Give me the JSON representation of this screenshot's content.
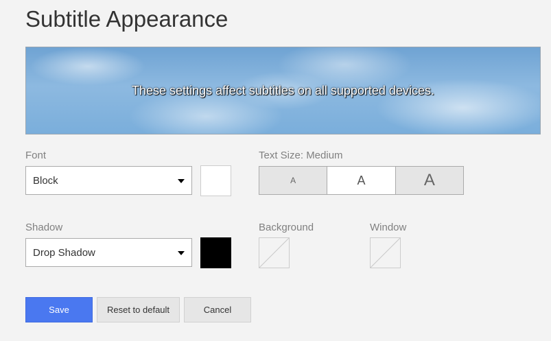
{
  "page": {
    "title": "Subtitle Appearance"
  },
  "preview": {
    "text": "These settings affect subtitles on all supported devices."
  },
  "font": {
    "label": "Font",
    "value": "Block",
    "color": "#ffffff"
  },
  "text_size": {
    "label": "Text Size: Medium",
    "options": [
      "A",
      "A",
      "A"
    ],
    "selected_index": 1
  },
  "shadow": {
    "label": "Shadow",
    "value": "Drop Shadow",
    "color": "#000000"
  },
  "background": {
    "label": "Background",
    "color": "none"
  },
  "window": {
    "label": "Window",
    "color": "none"
  },
  "buttons": {
    "save": "Save",
    "reset": "Reset to default",
    "cancel": "Cancel"
  },
  "colors": {
    "accent": "#4a78f0"
  }
}
